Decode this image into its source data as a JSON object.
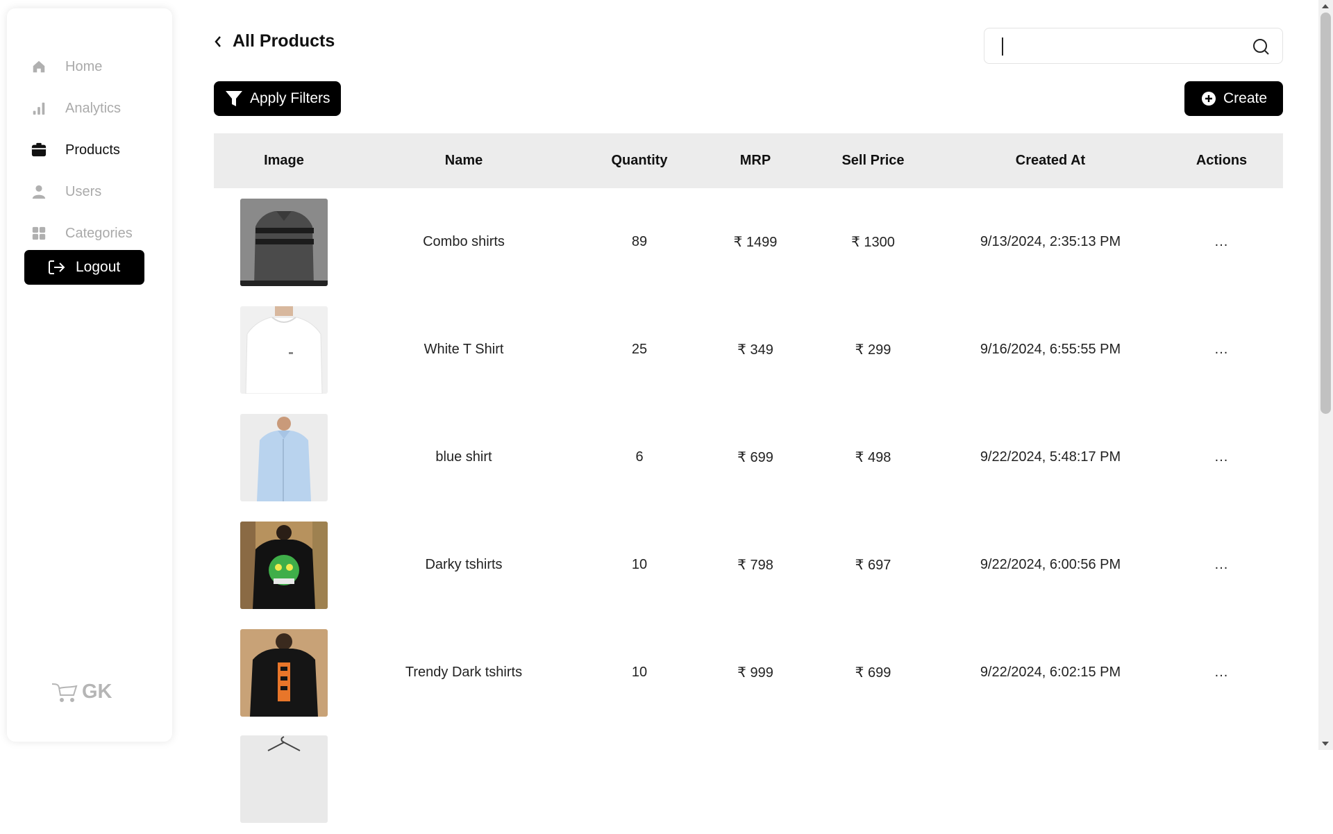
{
  "sidebar": {
    "items": [
      {
        "label": "Home",
        "icon": "home-icon"
      },
      {
        "label": "Analytics",
        "icon": "bar-chart-icon"
      },
      {
        "label": "Products",
        "icon": "box-icon"
      },
      {
        "label": "Users",
        "icon": "user-icon"
      },
      {
        "label": "Categories",
        "icon": "grid-icon"
      }
    ],
    "logout_label": "Logout",
    "brand": "GK"
  },
  "header": {
    "title": "All Products",
    "search": {
      "value": "",
      "placeholder": ""
    }
  },
  "toolbar": {
    "filter_label": "Apply Filters",
    "create_label": "Create"
  },
  "table": {
    "columns": [
      "Image",
      "Name",
      "Quantity",
      "MRP",
      "Sell Price",
      "Created At",
      "Actions"
    ],
    "rows": [
      {
        "name": "Combo shirts",
        "quantity": "89",
        "mrp": "₹ 1499",
        "sell_price": "₹ 1300",
        "created_at": "9/13/2024, 2:35:13 PM",
        "actions": "..."
      },
      {
        "name": "White T Shirt",
        "quantity": "25",
        "mrp": "₹ 349",
        "sell_price": "₹ 299",
        "created_at": "9/16/2024, 6:55:55 PM",
        "actions": "..."
      },
      {
        "name": "blue shirt",
        "quantity": "6",
        "mrp": "₹ 699",
        "sell_price": "₹ 498",
        "created_at": "9/22/2024, 5:48:17 PM",
        "actions": "..."
      },
      {
        "name": "Darky tshirts",
        "quantity": "10",
        "mrp": "₹ 798",
        "sell_price": "₹ 697",
        "created_at": "9/22/2024, 6:00:56 PM",
        "actions": "..."
      },
      {
        "name": "Trendy Dark tshirts",
        "quantity": "10",
        "mrp": "₹ 999",
        "sell_price": "₹ 699",
        "created_at": "9/22/2024, 6:02:15 PM",
        "actions": "..."
      }
    ]
  },
  "colors": {
    "primary": "#000000",
    "inactive_text": "#aaaaaa",
    "table_header_bg": "#ececec"
  }
}
